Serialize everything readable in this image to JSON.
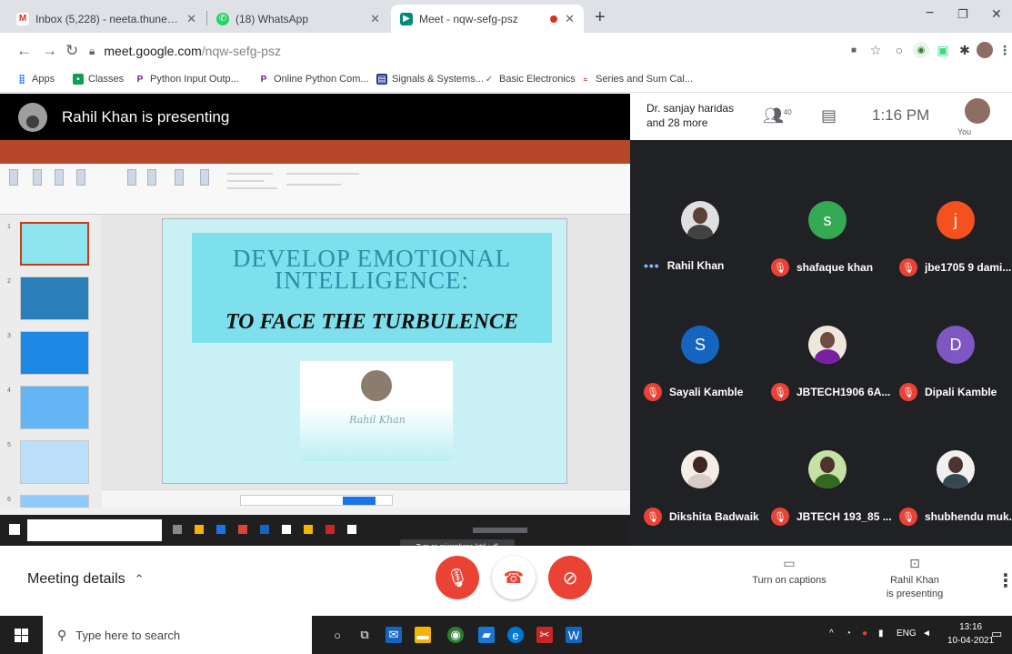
{
  "browser": {
    "tabs": [
      {
        "title": "Inbox (5,228) - neeta.thune@gm...",
        "icon": "gmail-icon",
        "color": "#d93025",
        "active": false
      },
      {
        "title": "(18) WhatsApp",
        "icon": "whatsapp-icon",
        "color": "#25d366",
        "active": false
      },
      {
        "title": "Meet - nqw-sefg-psz",
        "icon": "meet-icon",
        "color": "#00897b",
        "active": true
      }
    ],
    "url_domain": "meet.google.com",
    "url_path": "/nqw-sefg-psz",
    "bookmarks": [
      {
        "label": "Apps",
        "icon": "apps-grid-icon",
        "color": "#1a73e8"
      },
      {
        "label": "Classes",
        "icon": "classroom-icon",
        "color": "#0f9d58"
      },
      {
        "label": "Python Input Outp...",
        "icon": "python-site-icon",
        "color": "#6a1b9a"
      },
      {
        "label": "Online Python Com...",
        "icon": "python-site-icon",
        "color": "#6a1b9a"
      },
      {
        "label": "Signals & Systems...",
        "icon": "bookmark-page-icon",
        "color": "#283593"
      },
      {
        "label": "Basic Electronics",
        "icon": "bookmark-page-icon",
        "color": "#2e7d32"
      },
      {
        "label": "Series and Sum Cal...",
        "icon": "bookmark-page-icon",
        "color": "#c62828"
      }
    ]
  },
  "meet": {
    "presenting_title": "Rahil Khan is presenting",
    "participants_summary_line1": "Dr. sanjay haridas",
    "participants_summary_line2": "and 28 more",
    "people_count": "40",
    "time": "1:16 PM",
    "you_label": "You",
    "mic_tooltip": "Turn on microphone (ctrl + d)",
    "meeting_details": "Meeting details",
    "captions_label": "Turn on captions",
    "presenting_line1": "Rahil Khan",
    "presenting_line2": "is presenting"
  },
  "slide": {
    "heading": "DEVELOP EMOTIONAL INTELLIGENCE:",
    "subheading": "TO FACE THE TURBULENCE",
    "signature": "Rahil Khan"
  },
  "participants": [
    {
      "name": "Rahil Khan",
      "avatar": "photo",
      "color": "#7d7d7d",
      "initial": "",
      "status": "speaking"
    },
    {
      "name": "shafaque khan",
      "avatar": "letter",
      "color": "#34a853",
      "initial": "s",
      "status": "muted"
    },
    {
      "name": "jbe1705 9 dami...",
      "avatar": "letter",
      "color": "#f4511e",
      "initial": "j",
      "status": "muted"
    },
    {
      "name": "Sayali Kamble",
      "avatar": "letter",
      "color": "#1565c0",
      "initial": "S",
      "status": "muted"
    },
    {
      "name": "JBTECH1906 6A...",
      "avatar": "photo",
      "color": "#6d4c41",
      "initial": "",
      "status": "muted"
    },
    {
      "name": "Dipali Kamble",
      "avatar": "letter",
      "color": "#7e57c2",
      "initial": "D",
      "status": "muted"
    },
    {
      "name": "Dikshita Badwaik",
      "avatar": "photo",
      "color": "#4e342e",
      "initial": "",
      "status": "muted"
    },
    {
      "name": "JBTECH 193_85 ...",
      "avatar": "photo",
      "color": "#33691e",
      "initial": "",
      "status": "muted"
    },
    {
      "name": "shubhendu muk...",
      "avatar": "photo",
      "color": "#37474f",
      "initial": "",
      "status": "muted"
    }
  ],
  "taskbar": {
    "search_placeholder": "Type here to search",
    "lang": "ENG",
    "time": "13:16",
    "date": "10-04-2021"
  }
}
